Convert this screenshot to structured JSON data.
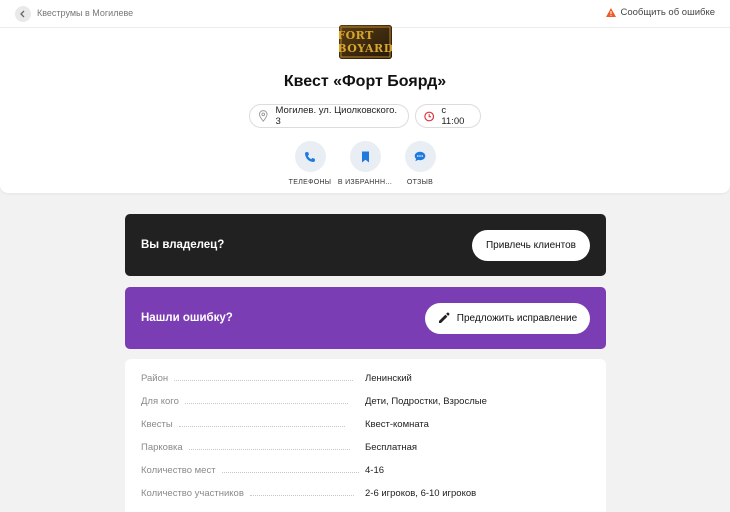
{
  "topbar": {
    "breadcrumb": "Квеструмы в Могилеве",
    "report_label": "Сообщить об ошибке"
  },
  "logo": {
    "text": "FORT BOYARD"
  },
  "title": "Квест «Форт Боярд»",
  "chips": {
    "address": "Могилев. ул. Циолковского. 3",
    "hours": "с 11:00"
  },
  "actions": [
    {
      "label": "ТЕЛЕФОНЫ",
      "icon": "phone-icon"
    },
    {
      "label": "В ИЗБРАННН...",
      "icon": "bookmark-icon"
    },
    {
      "label": "ОТЗЫВ",
      "icon": "chat-icon"
    }
  ],
  "owner_banner": {
    "text": "Вы владелец?",
    "button": "Привлечь клиентов"
  },
  "mistake_banner": {
    "text": "Нашли ошибку?",
    "button": "Предложить исправление"
  },
  "details": [
    {
      "key": "Район",
      "value": "Ленинский"
    },
    {
      "key": "Для кого",
      "value": "Дети, Подростки, Взрослые"
    },
    {
      "key": "Квесты",
      "value": "Квест-комната"
    },
    {
      "key": "Парковка",
      "value": "Бесплатная"
    },
    {
      "key": "Количество мест",
      "value": "4-16"
    },
    {
      "key": "Количество участников",
      "value": "2-6 игроков, 6-10 игроков"
    }
  ],
  "colors": {
    "accent_blue": "#1f7ae0",
    "owner_bg": "#212121",
    "mistake_bg": "#7b3db3",
    "warning": "#ef5a28",
    "clock_red": "#e0303a"
  }
}
